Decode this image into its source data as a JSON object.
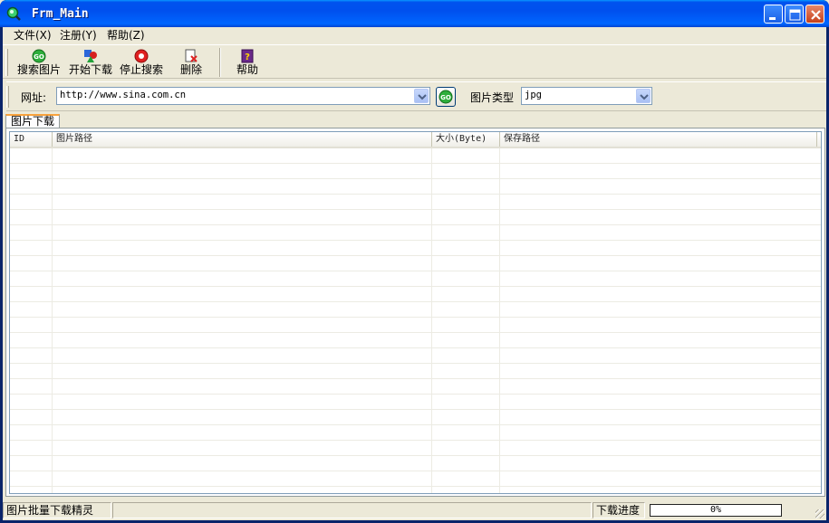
{
  "window": {
    "title": "Frm_Main"
  },
  "menu": [
    {
      "label": "文件(X)"
    },
    {
      "label": "注册(Y)"
    },
    {
      "label": "帮助(Z)"
    }
  ],
  "toolbar": {
    "search_label": "搜索图片",
    "start_label": "开始下载",
    "stop_label": "停止搜索",
    "delete_label": "删除",
    "help_label": "帮助"
  },
  "address": {
    "label": "网址:",
    "url": "http://www.sina.com.cn",
    "type_label": "图片类型",
    "type_value": "jpg"
  },
  "tabs": [
    {
      "label": "图片下载"
    }
  ],
  "table": {
    "columns": [
      "ID",
      "图片路径",
      "大小(Byte)",
      "保存路径"
    ],
    "rows": []
  },
  "status": {
    "app_name": "图片批量下载精灵",
    "progress_label": "下载进度",
    "progress_value": "0%"
  }
}
